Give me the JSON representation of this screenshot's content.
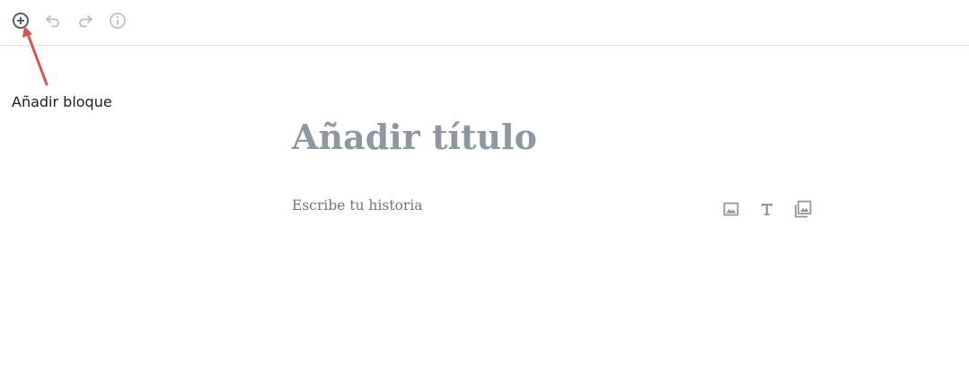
{
  "annotation": {
    "label": "Añadir bloque",
    "arrow_color": "#d9534f"
  },
  "toolbar": {
    "buttons": [
      {
        "name": "add-block",
        "icon": "plus-circle-icon"
      },
      {
        "name": "undo",
        "icon": "undo-icon"
      },
      {
        "name": "redo",
        "icon": "redo-icon"
      },
      {
        "name": "info",
        "icon": "info-icon"
      }
    ]
  },
  "editor": {
    "title_placeholder": "Añadir título",
    "body_placeholder": "Escribe tu historia",
    "inline_inserters": [
      {
        "name": "image",
        "icon": "image-icon"
      },
      {
        "name": "heading",
        "icon": "heading-icon"
      },
      {
        "name": "gallery",
        "icon": "gallery-icon"
      }
    ]
  },
  "colors": {
    "toolbar_icon_active": "#555d66",
    "toolbar_icon_disabled": "#b5bcc2",
    "title_placeholder": "#8f98a1",
    "body_placeholder": "#6c7781",
    "inserter_icon": "#8f98a1"
  }
}
